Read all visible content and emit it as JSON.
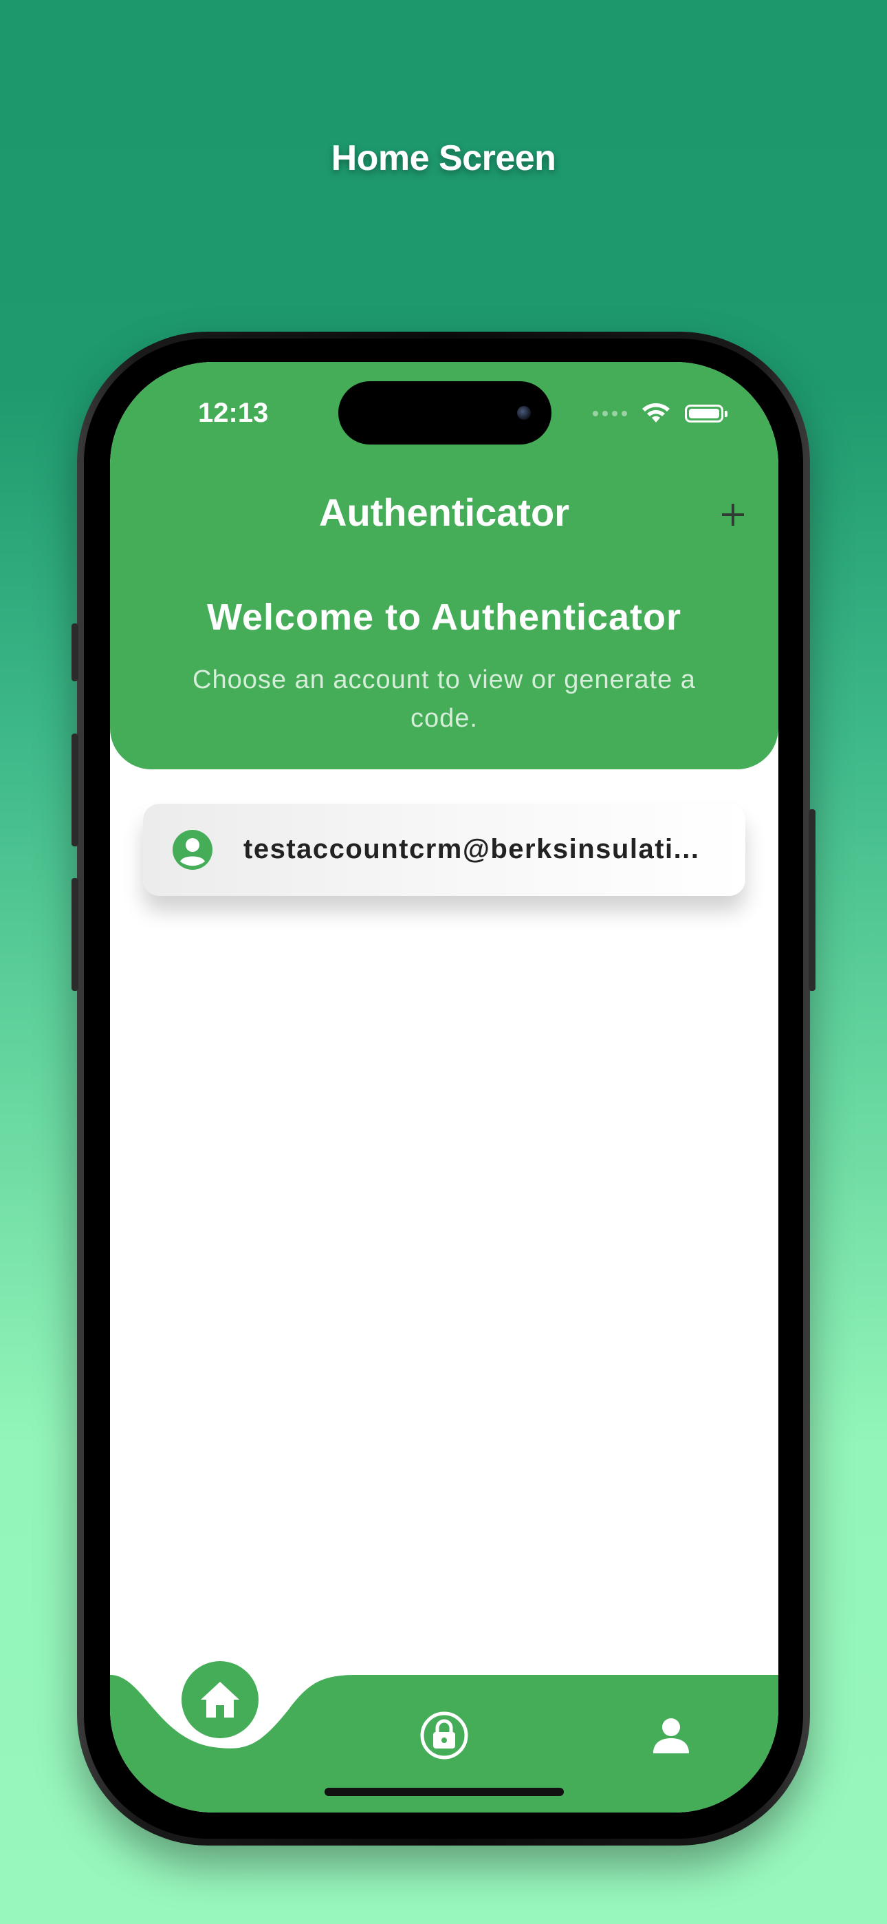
{
  "page": {
    "title": "Home Screen"
  },
  "status_bar": {
    "time": "12:13"
  },
  "header": {
    "title": "Authenticator",
    "add_icon": "plus-icon",
    "welcome_title": "Welcome to Authenticator",
    "welcome_subtitle": "Choose an account to view or generate a code."
  },
  "accounts": [
    {
      "email": "testaccountcrm@berksinsulati...",
      "icon": "account-circle-icon"
    }
  ],
  "tabbar": {
    "items": [
      {
        "icon": "home-icon",
        "active": true
      },
      {
        "icon": "lock-icon",
        "active": false
      },
      {
        "icon": "person-icon",
        "active": false
      }
    ]
  },
  "colors": {
    "primary": "#45ad58",
    "background_top": "#1d976c",
    "background_bottom": "#98f7bc",
    "text_dark": "#222222"
  }
}
